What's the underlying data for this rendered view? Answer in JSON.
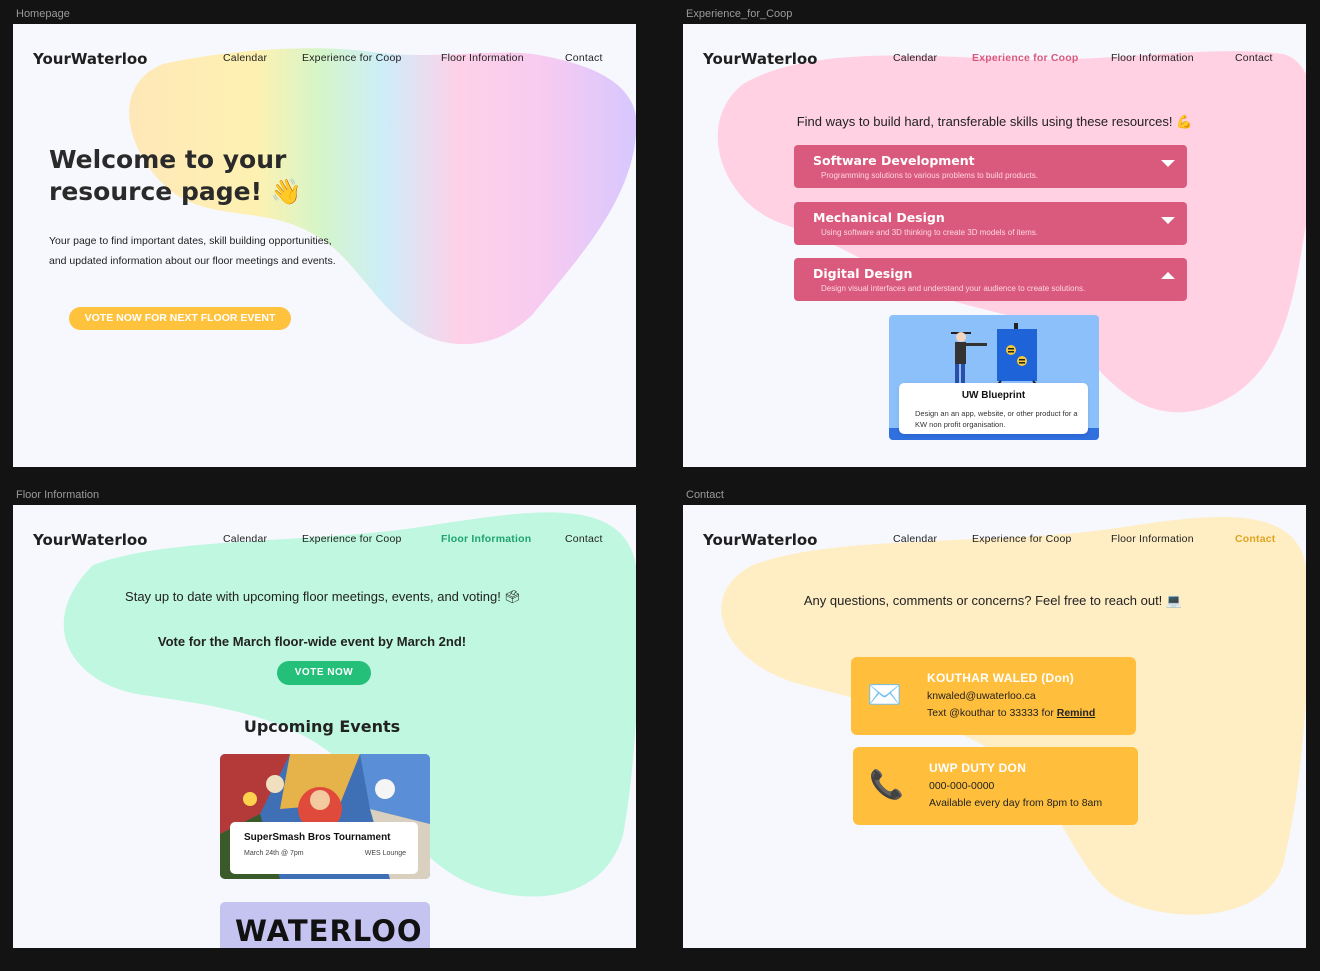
{
  "frames": {
    "homepage": "Homepage",
    "coop": "Experience_for_Coop",
    "floor": "Floor Information",
    "contact": "Contact"
  },
  "brand": "YourWaterloo",
  "nav": {
    "calendar": "Calendar",
    "coop": "Experience for Coop",
    "floor": "Floor Information",
    "contact": "Contact"
  },
  "colors": {
    "coop_accent": "#d95a7c",
    "floor_accent": "#24c07a",
    "contact_accent": "#ffbf3c",
    "home_button": "#ffc23d"
  },
  "homepage": {
    "title": "Welcome to your resource page! 👋",
    "description": "Your page to find important dates, skill building opportunities, and updated information about our floor meetings and events.",
    "vote_button": "VOTE NOW FOR NEXT FLOOR EVENT"
  },
  "coop": {
    "intro": "Find ways to build hard, transferable skills using these resources! 💪",
    "sections": [
      {
        "title": "Software Development",
        "subtitle": "Programming solutions to various problems to build products.",
        "expanded": false
      },
      {
        "title": "Mechanical Design",
        "subtitle": "Using software and 3D thinking to create 3D models of items.",
        "expanded": false
      },
      {
        "title": "Digital Design",
        "subtitle": "Design visual interfaces and understand your audience to create solutions.",
        "expanded": true
      }
    ],
    "project": {
      "title": "UW Blueprint",
      "description": "Design an an app, website, or other product for a KW non profit organisation."
    }
  },
  "floor": {
    "intro": "Stay up to date with upcoming floor meetings, events, and voting! 🗳",
    "vote_text": "Vote for the March floor-wide event by March 2nd!",
    "vote_button": "VOTE NOW",
    "events_title": "Upcoming Events",
    "event": {
      "title": "SuperSmash Bros Tournament",
      "date": "March 24th @ 7pm",
      "location": "WES Lounge"
    },
    "banner": "WATERLOO"
  },
  "contact": {
    "intro": "Any questions, comments or concerns? Feel free to reach out! 💻",
    "cards": [
      {
        "icon": "envelope-icon",
        "name": "KOUTHAR WALED (Don)",
        "line1": "knwaled@uwaterloo.ca",
        "line2_prefix": "Text @kouthar to 33333 for ",
        "line2_link": "Remind"
      },
      {
        "icon": "phone-icon",
        "name": "UWP DUTY DON",
        "line1": "000-000-0000",
        "line2": "Available every day from 8pm to 8am"
      }
    ]
  }
}
